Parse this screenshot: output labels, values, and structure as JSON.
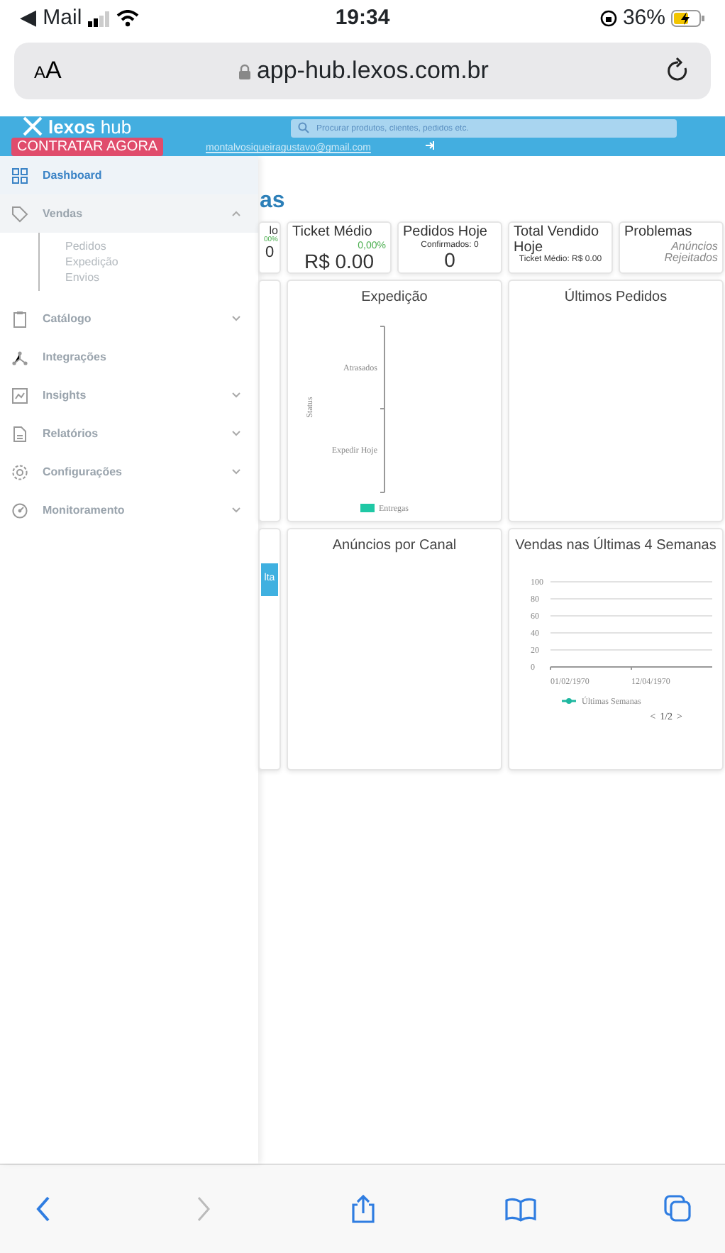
{
  "status_bar": {
    "back_app": "◀ Mail",
    "time": "19:34",
    "battery": "36%"
  },
  "address_bar": {
    "text_size": "AA",
    "url": "app-hub.lexos.com.br"
  },
  "header": {
    "logo": "**lexos** hub",
    "search": {
      "placeholder": "Procurar produtos, clientes, pedidos etc."
    },
    "email": "montalvosiqueiragustavo@gmail.com",
    "promo": "CONTRATAR AGORA"
  },
  "sidebar": {
    "items": [
      {
        "label": "Dashboard",
        "kind": "link",
        "selected": true
      },
      {
        "label": "Vendas",
        "kind": "group",
        "selected": false,
        "expanded": true,
        "children": [
          {
            "label": "Pedidos"
          },
          {
            "label": "Expedição"
          },
          {
            "label": "Envios"
          }
        ]
      },
      {
        "label": "Catálogo",
        "kind": "group",
        "selected": false,
        "expanded": false
      },
      {
        "label": "Integrações",
        "kind": "link",
        "selected": false
      },
      {
        "label": "Insights",
        "kind": "group",
        "selected": false,
        "expanded": false
      },
      {
        "label": "Relatórios",
        "kind": "group",
        "selected": false,
        "expanded": false
      },
      {
        "label": "Configurações",
        "kind": "group",
        "selected": false,
        "expanded": false
      },
      {
        "label": "Monitoramento",
        "kind": "group",
        "selected": false,
        "expanded": false
      }
    ]
  },
  "page_title": "as",
  "stat_cards": [
    {
      "kind": "metric",
      "title": "lo",
      "change": "00%",
      "value": "0"
    },
    {
      "kind": "metric",
      "title": "Ticket Médio",
      "change": "0,00%",
      "value": "R$ 0.00"
    },
    {
      "kind": "metric",
      "title": "Pedidos Hoje",
      "note": "Confirmados: 0",
      "value": "0"
    },
    {
      "kind": "metric",
      "title": "Total Vendido Hoje",
      "note": "Ticket Médio: R$ 0.00"
    },
    {
      "kind": "alert",
      "title": "Problemas",
      "note": "Anúncios Rejeitados"
    }
  ],
  "panel_rows": [
    [
      {
        "kind": "partial"
      },
      {
        "kind": "bar_picture",
        "title": "Expedição",
        "axis_title": "Status",
        "axis_labels": [
          "Atrasados",
          "Expedir Hoje"
        ],
        "legend": {
          "name": "Entregas",
          "color": "#1fc8a5"
        }
      },
      {
        "kind": "empty",
        "title": "Últimos Pedidos"
      }
    ],
    [
      {
        "kind": "partial",
        "button": "lta"
      },
      {
        "kind": "empty",
        "title": "Anúncios por Canal"
      },
      {
        "kind": "chart",
        "title": "Vendas nas Últimas 4 Semanas",
        "chart_data": {
          "type": "line",
          "x": [
            "01/02/1970",
            "12/04/1970"
          ],
          "ylim": [
            0,
            100
          ],
          "grid": true,
          "yticks": [
            0,
            20,
            40,
            60,
            80,
            100
          ],
          "series": [
            {
              "name": "Últimas Semanas",
              "color": "#1fb8a0",
              "values": [
                null,
                null
              ]
            }
          ]
        },
        "pager": {
          "prev": "<",
          "page": "1/2",
          "next": ">"
        }
      }
    ]
  ]
}
